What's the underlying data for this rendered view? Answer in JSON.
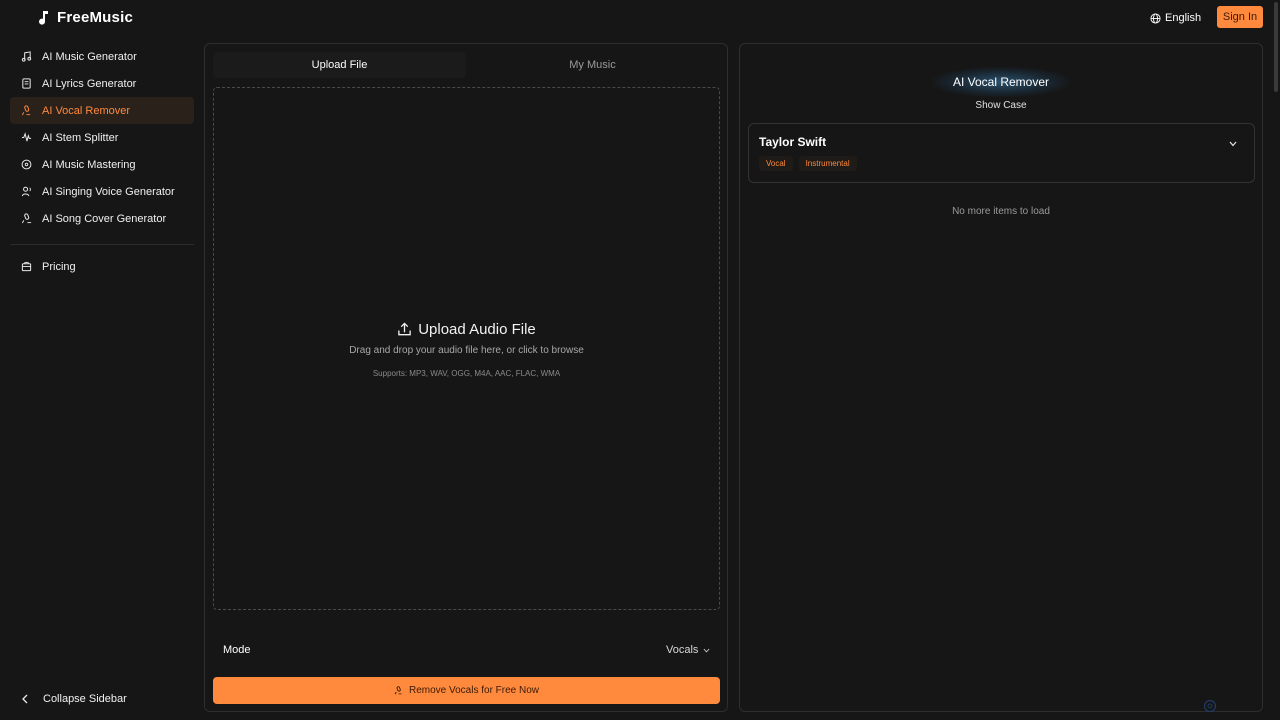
{
  "header": {
    "brand": "FreeMusic",
    "language": "English",
    "sign_in": "Sign In"
  },
  "sidebar": {
    "items": [
      {
        "label": "AI Music Generator",
        "icon": "music-note-icon",
        "active": false
      },
      {
        "label": "AI Lyrics Generator",
        "icon": "document-icon",
        "active": false
      },
      {
        "label": "AI Vocal Remover",
        "icon": "microphone-icon",
        "active": true
      },
      {
        "label": "AI Stem Splitter",
        "icon": "waveform-icon",
        "active": false
      },
      {
        "label": "AI Music Mastering",
        "icon": "disc-icon",
        "active": false
      },
      {
        "label": "AI Singing Voice Generator",
        "icon": "singer-icon",
        "active": false
      },
      {
        "label": "AI Song Cover Generator",
        "icon": "microphone-pen-icon",
        "active": false
      }
    ],
    "pricing": "Pricing",
    "collapse": "Collapse Sidebar"
  },
  "upload_panel": {
    "tabs": [
      "Upload File",
      "My Music"
    ],
    "active_tab": "Upload File",
    "title": "Upload Audio File",
    "subtitle": "Drag and drop your audio file here, or click to browse",
    "supports": "Supports: MP3, WAV, OGG, M4A, AAC, FLAC, WMA",
    "mode_label": "Mode",
    "mode_value": "Vocals",
    "cta": "Remove Vocals for Free Now"
  },
  "showcase": {
    "title": "AI Vocal Remover",
    "subtitle": "Show Case",
    "card": {
      "title": "Taylor Swift",
      "tags": [
        "Vocal",
        "Instrumental"
      ]
    },
    "empty_text": "No more items to load"
  },
  "colors": {
    "accent": "#ff8a3d",
    "background": "#161616",
    "panel_border": "#2e2e2e"
  }
}
